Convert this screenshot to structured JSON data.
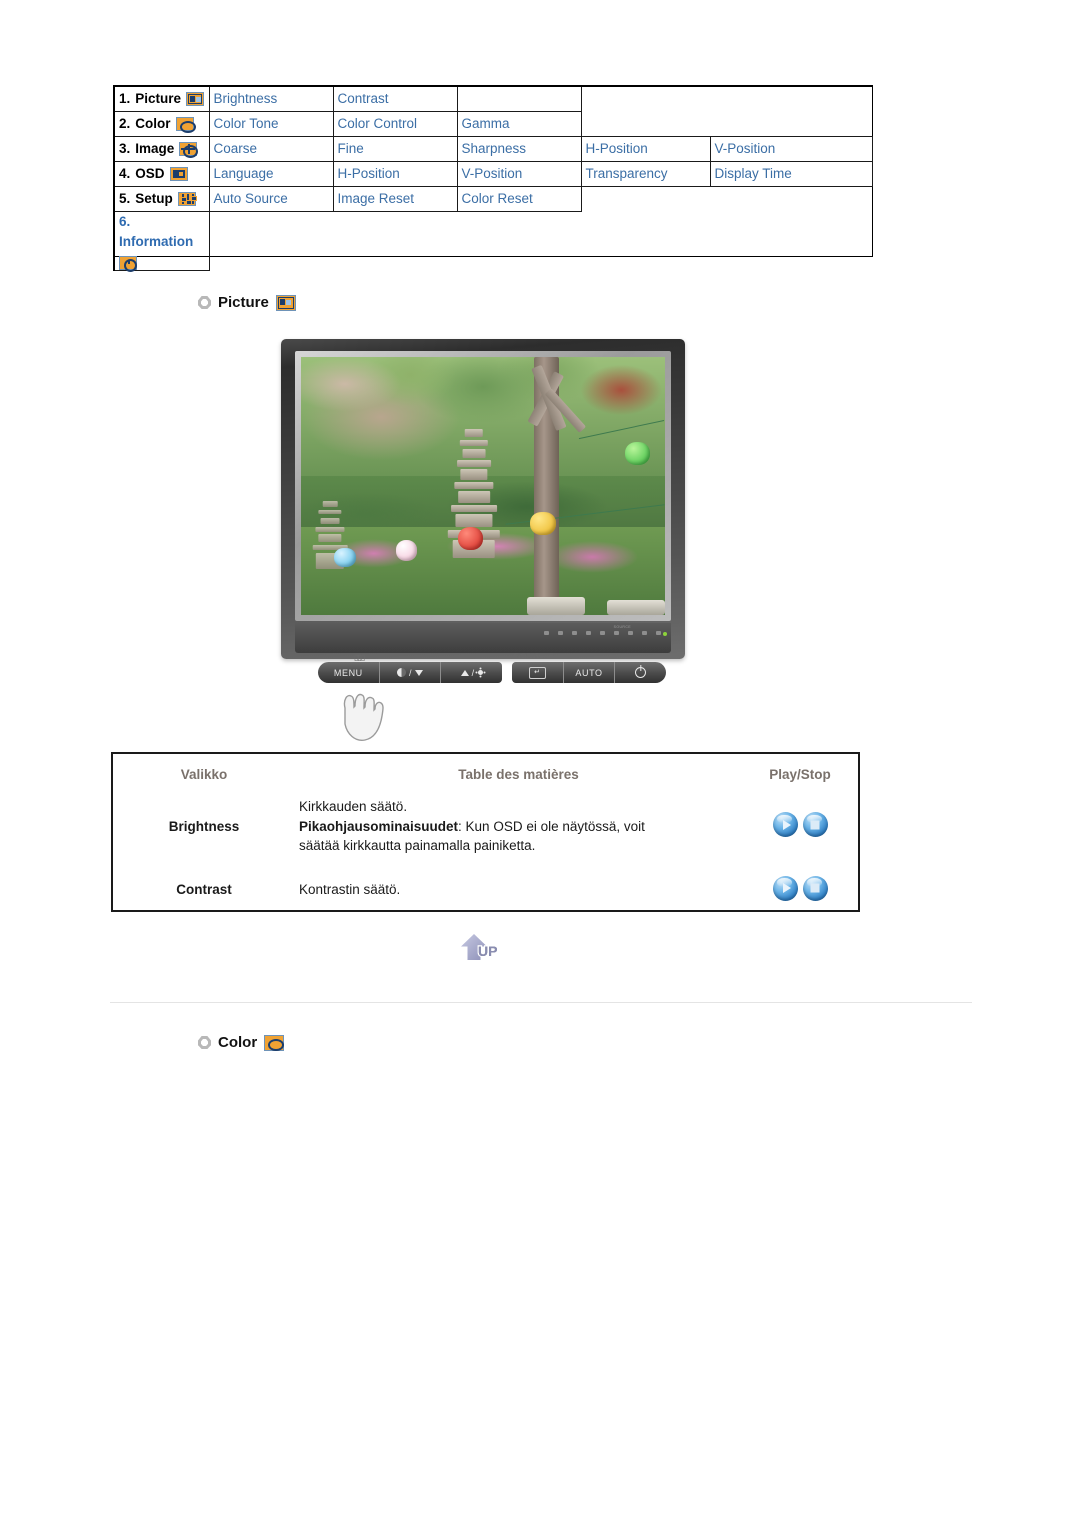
{
  "menu_map": {
    "rows": [
      {
        "index": "1.",
        "category": "Picture",
        "icon": "picture-icon",
        "items": [
          "Brightness",
          "Contrast"
        ],
        "trailing_blank": 1
      },
      {
        "index": "2.",
        "category": "Color",
        "icon": "color-icon",
        "items": [
          "Color Tone",
          "Color Control",
          "Gamma"
        ],
        "trailing_blank": 0
      },
      {
        "index": "3.",
        "category": "Image",
        "icon": "image-icon",
        "items": [
          "Coarse",
          "Fine",
          "Sharpness",
          "H-Position",
          "V-Position"
        ],
        "trailing_blank": 0
      },
      {
        "index": "4.",
        "category": "OSD",
        "icon": "osd-icon",
        "items": [
          "Language",
          "H-Position",
          "V-Position",
          "Transparency",
          "Display Time"
        ],
        "trailing_blank": 0
      },
      {
        "index": "5.",
        "category": "Setup",
        "icon": "setup-icon",
        "items": [
          "Auto Source",
          "Image Reset",
          "Color Reset"
        ],
        "trailing_blank": 0
      },
      {
        "index": "6.",
        "category": "Information",
        "icon": "information-icon",
        "items": [],
        "trailing_blank": 0
      }
    ],
    "link_color": "#3b6ea5",
    "information_color": "#2f6bb0"
  },
  "sections": [
    {
      "title": "Picture",
      "icon": "picture-icon"
    },
    {
      "title": "Color",
      "icon": "color-icon"
    }
  ],
  "monitor": {
    "buttons": [
      {
        "label": "MENU",
        "glyph": "none",
        "name": "menu-button"
      },
      {
        "label": "",
        "glyph": "contrast-down",
        "name": "contrast-down-button"
      },
      {
        "label": "",
        "glyph": "up-brightness",
        "name": "brightness-up-button"
      },
      {
        "label": "",
        "glyph": "enter",
        "name": "source-enter-button"
      },
      {
        "label": "AUTO",
        "glyph": "none",
        "name": "auto-button"
      },
      {
        "label": "",
        "glyph": "power",
        "name": "power-button"
      }
    ],
    "source_label": "SOURCE",
    "menu_ticks": "▯▯▯"
  },
  "desc_table": {
    "headers": [
      "Valikko",
      "Table des matières",
      "Play/Stop"
    ],
    "rows": [
      {
        "menu": "Brightness",
        "lines": [
          {
            "text": "Kirkkauden säätö.",
            "bold_prefix": ""
          },
          {
            "text": ": Kun OSD ei ole näytössä, voit",
            "bold_prefix": "Pikaohjausominaisuudet"
          },
          {
            "text": "säätää kirkkautta painamalla painiketta.",
            "bold_prefix": ""
          }
        ],
        "controls": [
          "play-button",
          "stop-button"
        ]
      },
      {
        "menu": "Contrast",
        "lines": [
          {
            "text": "Kontrastin säätö.",
            "bold_prefix": ""
          }
        ],
        "controls": [
          "play-button",
          "stop-button"
        ]
      }
    ],
    "header_color": "#7a716b"
  },
  "up_button": {
    "label": "UP",
    "icon": "up-arrow-icon"
  }
}
